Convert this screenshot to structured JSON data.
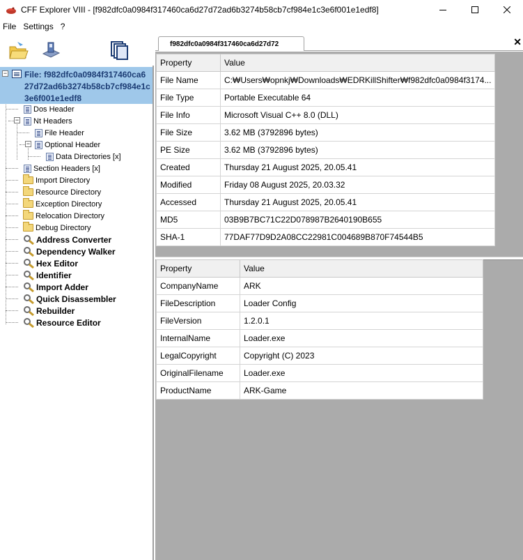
{
  "window": {
    "title": "CFF Explorer VIII - [f982dfc0a0984f317460ca6d27d72ad6b3274b58cb7cf984e1c3e6f001e1edf8]",
    "minimize_glyph": "—",
    "maximize_glyph": "☐",
    "close_glyph": "✕"
  },
  "menu": [
    "File",
    "Settings",
    "?"
  ],
  "toolbar": {
    "buttons": [
      "open-file-icon",
      "save-file-icon",
      "windows-icon"
    ]
  },
  "tree": {
    "root_label": "File: f982dfc0a0984f317460ca6d27d72ad6b3274b58cb7cf984e1c3e6f001e1edf8",
    "root_lines": [
      "File: f982dfc0a0984f317460ca6",
      "27d72ad6b3274b58cb7cf984e1c",
      "3e6f001e1edf8"
    ],
    "items": [
      {
        "label": "Dos Header",
        "icon": "doc-icon"
      },
      {
        "label": "Nt Headers",
        "icon": "doc-icon"
      },
      {
        "label": "File Header",
        "icon": "doc-icon"
      },
      {
        "label": "Optional Header",
        "icon": "doc-icon"
      },
      {
        "label": "Data Directories [x]",
        "icon": "doc-icon"
      },
      {
        "label": "Section Headers [x]",
        "icon": "doc-icon"
      },
      {
        "label": "Import Directory",
        "icon": "folder-icon"
      },
      {
        "label": "Resource Directory",
        "icon": "folder-icon"
      },
      {
        "label": "Exception Directory",
        "icon": "folder-icon"
      },
      {
        "label": "Relocation Directory",
        "icon": "folder-icon"
      },
      {
        "label": "Debug Directory",
        "icon": "folder-icon"
      },
      {
        "label": "Address Converter",
        "icon": "tool-icon"
      },
      {
        "label": "Dependency Walker",
        "icon": "tool-icon"
      },
      {
        "label": "Hex Editor",
        "icon": "tool-icon"
      },
      {
        "label": "Identifier",
        "icon": "tool-icon"
      },
      {
        "label": "Import Adder",
        "icon": "tool-icon"
      },
      {
        "label": "Quick Disassembler",
        "icon": "tool-icon"
      },
      {
        "label": "Rebuilder",
        "icon": "tool-icon"
      },
      {
        "label": "Resource Editor",
        "icon": "tool-icon"
      }
    ]
  },
  "tab": {
    "label": "f982dfc0a0984f317460ca6d27d72",
    "close_glyph": "✕"
  },
  "file_props": {
    "headers": [
      "Property",
      "Value"
    ],
    "rows": [
      [
        "File Name",
        "C:₩Users₩opnkj₩Downloads₩EDRKillShifter₩f982dfc0a0984f3174..."
      ],
      [
        "File Type",
        "Portable Executable 64"
      ],
      [
        "File Info",
        "Microsoft Visual C++ 8.0 (DLL)"
      ],
      [
        "File Size",
        "3.62 MB (3792896 bytes)"
      ],
      [
        "PE Size",
        "3.62 MB (3792896 bytes)"
      ],
      [
        "Created",
        "Thursday 21 August 2025, 20.05.41"
      ],
      [
        "Modified",
        "Friday 08 August 2025, 20.03.32"
      ],
      [
        "Accessed",
        "Thursday 21 August 2025, 20.05.41"
      ],
      [
        "MD5",
        "03B9B7BC71C22D078987B2640190B655"
      ],
      [
        "SHA-1",
        "77DAF77D9D2A08CC22981C004689B870F74544B5"
      ]
    ]
  },
  "version_props": {
    "headers": [
      "Property",
      "Value"
    ],
    "rows": [
      [
        "CompanyName",
        "ARK"
      ],
      [
        "FileDescription",
        "Loader Config"
      ],
      [
        "FileVersion",
        "1.2.0.1"
      ],
      [
        "InternalName",
        "Loader.exe"
      ],
      [
        "LegalCopyright",
        "Copyright (C) 2023"
      ],
      [
        "OriginalFilename",
        "Loader.exe"
      ],
      [
        "ProductName",
        "ARK-Game"
      ]
    ]
  }
}
